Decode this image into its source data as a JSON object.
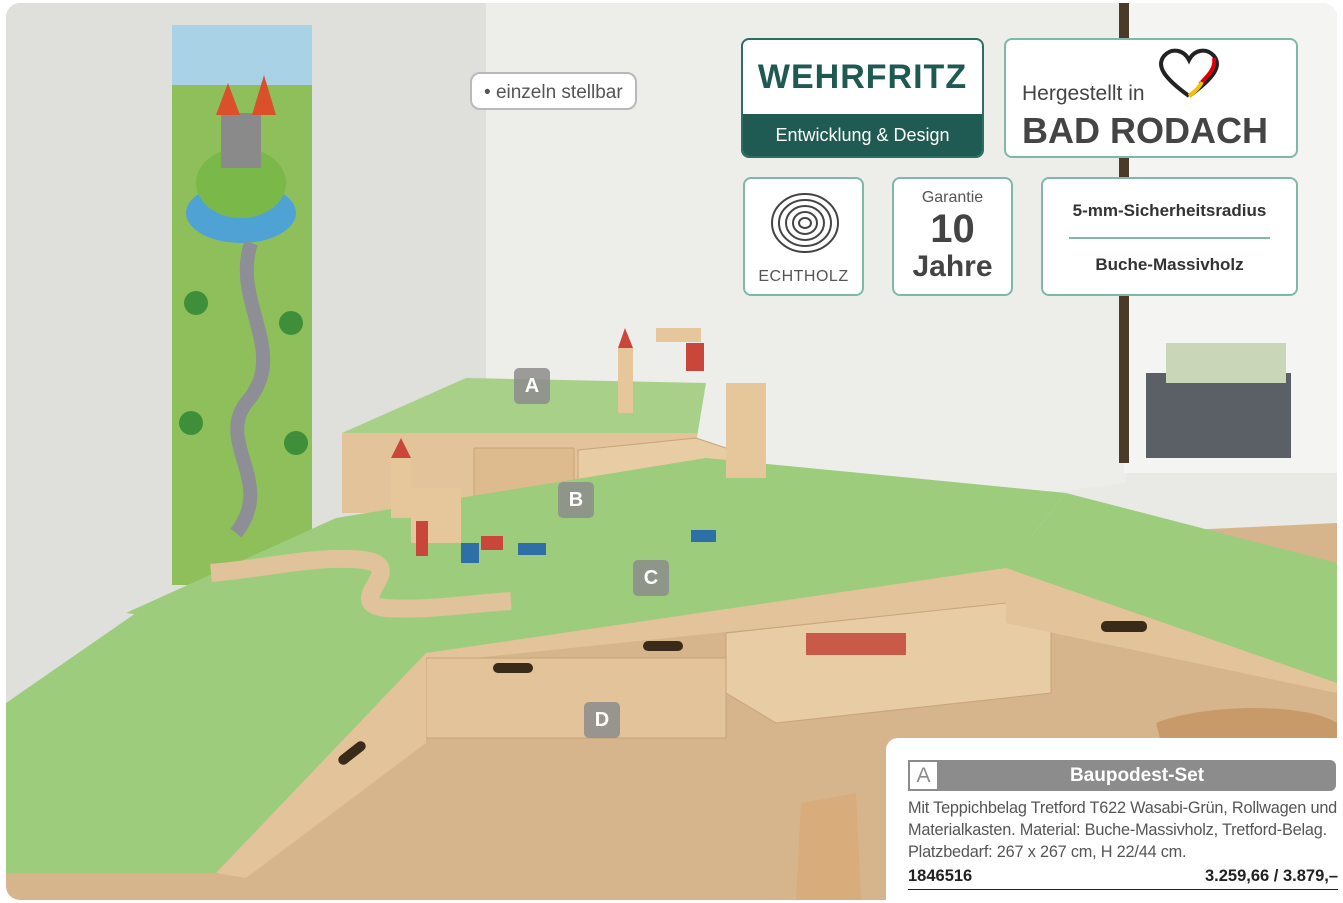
{
  "pill": "einzeln stellbar",
  "brand": {
    "name": "WEHRFRITZ",
    "subtitle": "Entwicklung & Design"
  },
  "made_in": {
    "line1": "Hergestellt in",
    "line2": "BAD RODACH"
  },
  "wood_badge": {
    "label": "ECHTHOLZ"
  },
  "guarantee": {
    "label": "Garantie",
    "value": "10",
    "unit": "Jahre"
  },
  "features": [
    "5-mm-Sicherheitsradius",
    "Buche-Massivholz"
  ],
  "markers": [
    "A",
    "B",
    "C",
    "D"
  ],
  "product": {
    "letter": "A",
    "title": "Baupodest-Set",
    "description": "Mit Teppichbelag Tretford T622 Wasabi-Grün, Rollwagen und Materialkasten. Material: Buche-Massivholz, Tretford-Belag. Platzbedarf: 267 x 267 cm, H 22/44 cm.",
    "article_number": "1846516",
    "price": "3.259,66 / 3.879,–"
  },
  "colors": {
    "brand_green": "#1f5b53",
    "badge_border": "#7fb8a8",
    "carpet": "#9ccc7c",
    "wood": "#e3c39a",
    "marker_grey": "#8c8c8c"
  }
}
